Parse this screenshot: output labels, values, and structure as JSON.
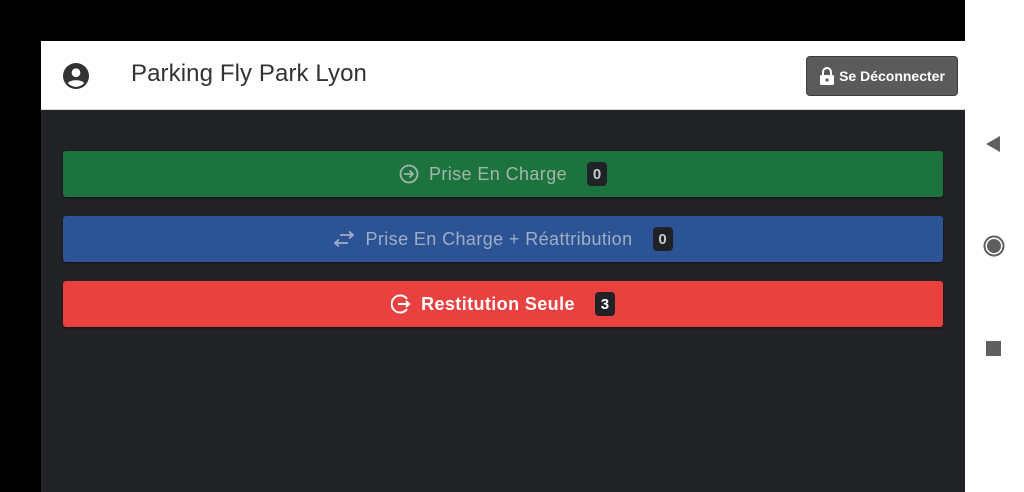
{
  "header": {
    "title": "Parking Fly Park Lyon",
    "user_icon": "account-circle-icon",
    "logout_label": "Se Déconnecter",
    "logout_icon": "lock-icon"
  },
  "actions": [
    {
      "label": "Prise En Charge",
      "count": "0",
      "icon": "arrow-circle-right-icon",
      "color": "#1c733e",
      "enabled": false
    },
    {
      "label": "Prise En Charge + Réattribution",
      "count": "0",
      "icon": "swap-arrows-icon",
      "color": "#2c5494",
      "enabled": false
    },
    {
      "label": "Restitution Seule",
      "count": "3",
      "icon": "arrow-circle-exit-icon",
      "color": "#e94040",
      "enabled": true
    }
  ],
  "android_nav": {
    "back_icon": "back-triangle-icon",
    "home_icon": "home-circle-icon",
    "recent_icon": "recent-square-icon"
  }
}
